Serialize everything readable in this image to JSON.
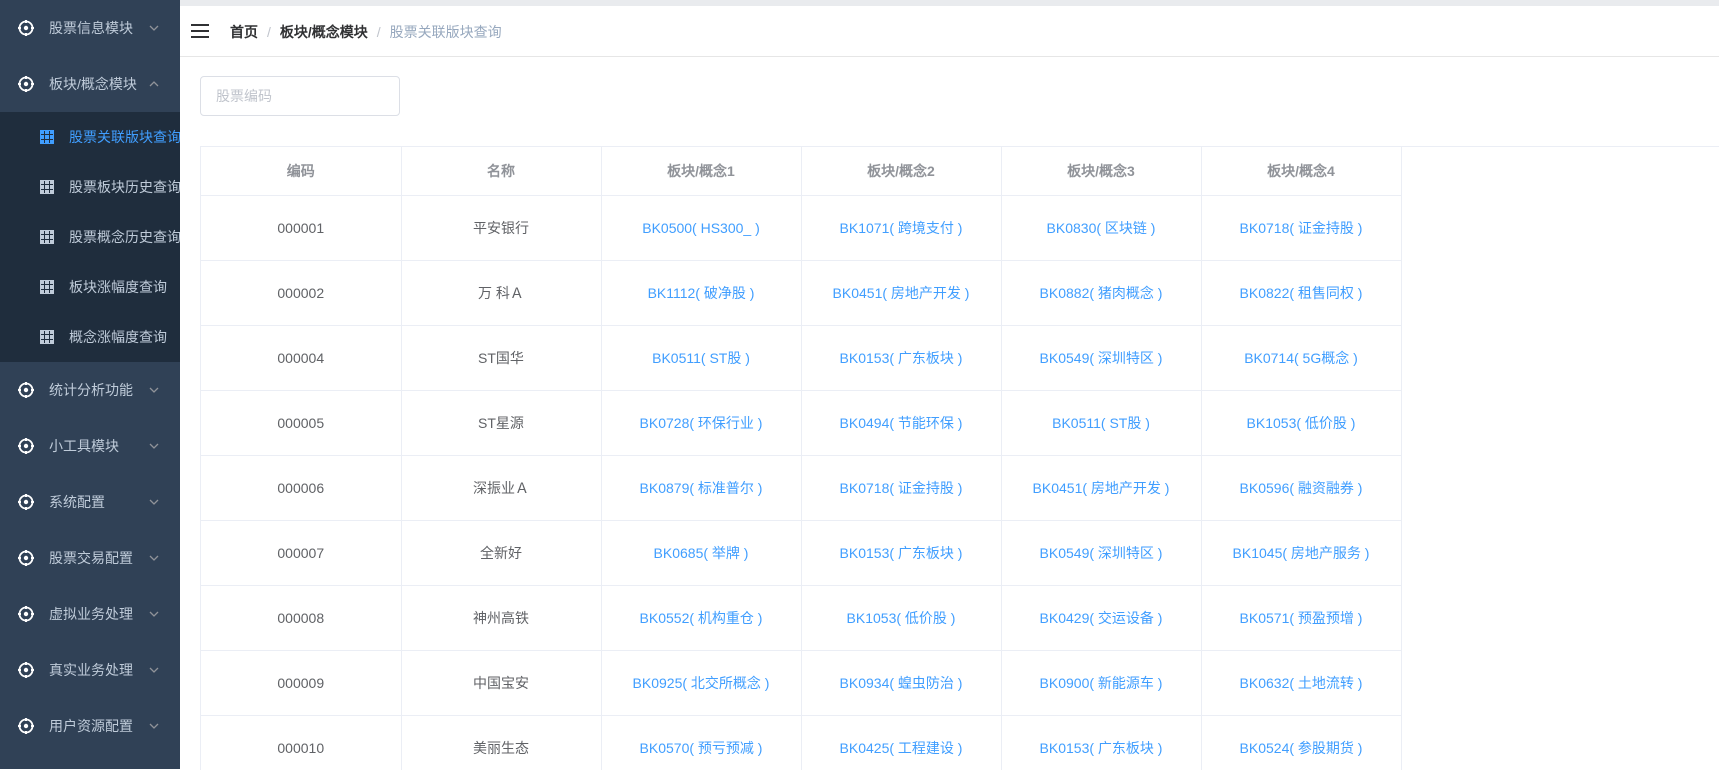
{
  "sidebar": {
    "groups": [
      {
        "label": "股票信息模块",
        "expanded": false
      },
      {
        "label": "板块/概念模块",
        "expanded": true
      },
      {
        "label": "统计分析功能",
        "expanded": false
      },
      {
        "label": "小工具模块",
        "expanded": false
      },
      {
        "label": "系统配置",
        "expanded": false
      },
      {
        "label": "股票交易配置",
        "expanded": false
      },
      {
        "label": "虚拟业务处理",
        "expanded": false
      },
      {
        "label": "真实业务处理",
        "expanded": false
      },
      {
        "label": "用户资源配置",
        "expanded": false
      }
    ],
    "submenu": [
      {
        "label": "股票关联版块查询",
        "active": true
      },
      {
        "label": "股票板块历史查询",
        "active": false
      },
      {
        "label": "股票概念历史查询",
        "active": false
      },
      {
        "label": "板块涨幅度查询",
        "active": false
      },
      {
        "label": "概念涨幅度查询",
        "active": false
      }
    ]
  },
  "breadcrumb": {
    "home": "首页",
    "section": "板块/概念模块",
    "current": "股票关联版块查询",
    "separator": "/"
  },
  "search": {
    "placeholder": "股票编码",
    "value": ""
  },
  "table": {
    "headers": [
      "编码",
      "名称",
      "板块/概念1",
      "板块/概念2",
      "板块/概念3",
      "板块/概念4"
    ],
    "rows": [
      [
        "000001",
        "平安银行",
        "BK0500( HS300_ )",
        "BK1071( 跨境支付 )",
        "BK0830( 区块链 )",
        "BK0718( 证金持股 )"
      ],
      [
        "000002",
        "万 科Ａ",
        "BK1112( 破净股 )",
        "BK0451( 房地产开发 )",
        "BK0882( 猪肉概念 )",
        "BK0822( 租售同权 )"
      ],
      [
        "000004",
        "ST国华",
        "BK0511( ST股 )",
        "BK0153( 广东板块 )",
        "BK0549( 深圳特区 )",
        "BK0714( 5G概念 )"
      ],
      [
        "000005",
        "ST星源",
        "BK0728( 环保行业 )",
        "BK0494( 节能环保 )",
        "BK0511( ST股 )",
        "BK1053( 低价股 )"
      ],
      [
        "000006",
        "深振业Ａ",
        "BK0879( 标准普尔 )",
        "BK0718( 证金持股 )",
        "BK0451( 房地产开发 )",
        "BK0596( 融资融券 )"
      ],
      [
        "000007",
        "全新好",
        "BK0685( 举牌 )",
        "BK0153( 广东板块 )",
        "BK0549( 深圳特区 )",
        "BK1045( 房地产服务 )"
      ],
      [
        "000008",
        "神州高铁",
        "BK0552( 机构重仓 )",
        "BK1053( 低价股 )",
        "BK0429( 交运设备 )",
        "BK0571( 预盈预增 )"
      ],
      [
        "000009",
        "中国宝安",
        "BK0925( 北交所概念 )",
        "BK0934( 蝗虫防治 )",
        "BK0900( 新能源车 )",
        "BK0632( 土地流转 )"
      ],
      [
        "000010",
        "美丽生态",
        "BK0570( 预亏预减 )",
        "BK0425( 工程建设 )",
        "BK0153( 广东板块 )",
        "BK0524( 参股期货 )"
      ]
    ]
  },
  "colors": {
    "sidebar_bg": "#304156",
    "submenu_bg": "#1f2d3d",
    "sidebar_text": "#bfcbd9",
    "accent": "#409eff",
    "link": "#409eff"
  },
  "icons": {
    "group": "gear-icon",
    "submenu": "grid-table-icon",
    "chevron": "chevron-icon",
    "menu_toggle": "hamburger-icon"
  }
}
